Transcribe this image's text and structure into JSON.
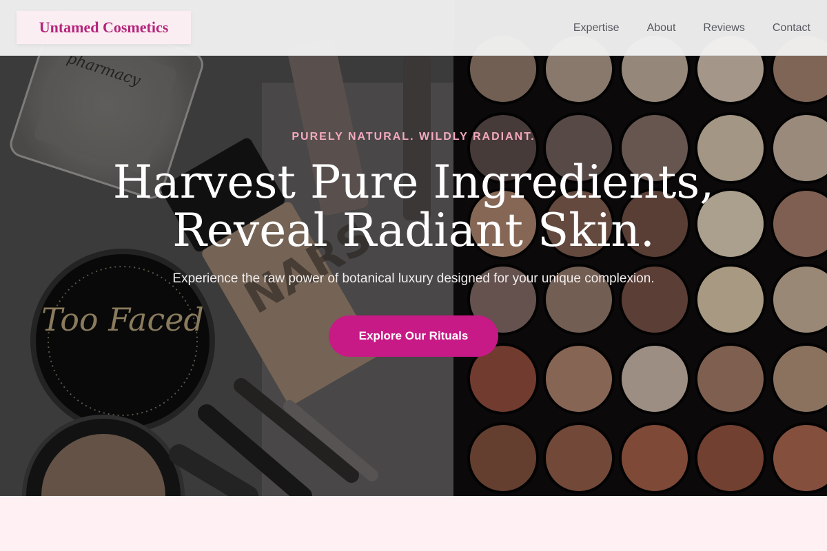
{
  "header": {
    "brand": "Untamed Cosmetics",
    "nav": [
      "Expertise",
      "About",
      "Reviews",
      "Contact"
    ]
  },
  "hero": {
    "eyebrow": "PURELY NATURAL. WILDLY RADIANT.",
    "headline_line1": "Harvest Pure Ingredients,",
    "headline_line2": "Reveal Radiant Skin.",
    "subline": "Experience the raw power of botanical luxury designed for your unique complexion.",
    "cta_label": "Explore Our Rituals"
  },
  "colors": {
    "brand": "#b5247c",
    "accent": "#c71a86",
    "eyebrow": "#f4a9bf",
    "lower_band": "#fff0f4"
  },
  "imagery": {
    "compact_text": "Too Faced",
    "bottle_text": "pharmacy",
    "foundation_text": "NARS"
  }
}
